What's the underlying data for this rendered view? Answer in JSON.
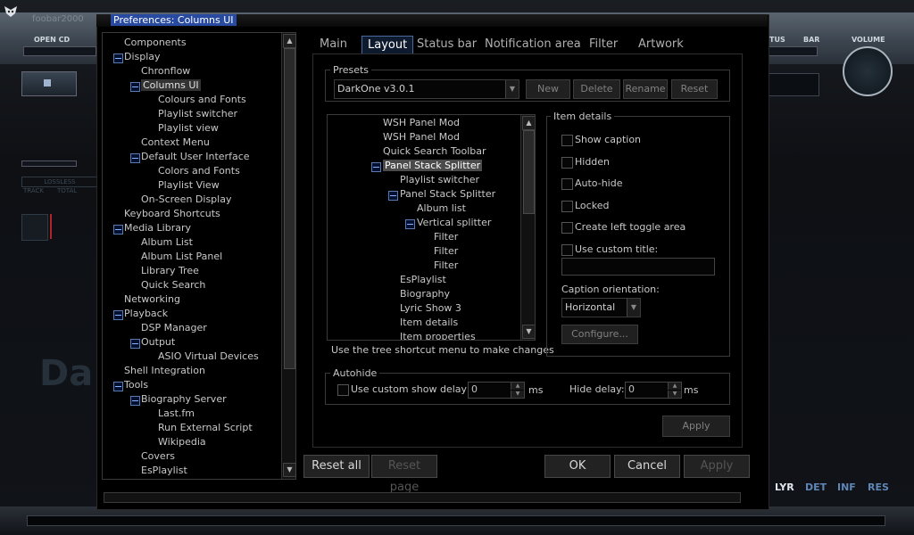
{
  "background": {
    "player_title": "foobar2000",
    "labels": {
      "open_cd": "OPEN CD",
      "tus": "TUS",
      "bar": "BAR",
      "volume": "VOLUME",
      "lossless": "LOSSLESS",
      "track": "TRACK",
      "total": "TOTAL"
    },
    "big_text": "Da",
    "side_tabs": [
      "LYR",
      "DET",
      "INF",
      "RES"
    ]
  },
  "dialog": {
    "title": "Preferences: Columns UI",
    "tree": [
      {
        "label": "Components",
        "level": 0,
        "expander": false
      },
      {
        "label": "Display",
        "level": 0,
        "expander": true
      },
      {
        "label": "Chronflow",
        "level": 1,
        "expander": false
      },
      {
        "label": "Columns UI",
        "level": 1,
        "expander": true,
        "selected": true
      },
      {
        "label": "Colours and Fonts",
        "level": 2,
        "expander": false
      },
      {
        "label": "Playlist switcher",
        "level": 2,
        "expander": false
      },
      {
        "label": "Playlist view",
        "level": 2,
        "expander": false
      },
      {
        "label": "Context Menu",
        "level": 1,
        "expander": false
      },
      {
        "label": "Default User Interface",
        "level": 1,
        "expander": true
      },
      {
        "label": "Colors and Fonts",
        "level": 2,
        "expander": false
      },
      {
        "label": "Playlist View",
        "level": 2,
        "expander": false
      },
      {
        "label": "On-Screen Display",
        "level": 1,
        "expander": false
      },
      {
        "label": "Keyboard Shortcuts",
        "level": 0,
        "expander": false
      },
      {
        "label": "Media Library",
        "level": 0,
        "expander": true
      },
      {
        "label": "Album List",
        "level": 1,
        "expander": false
      },
      {
        "label": "Album List Panel",
        "level": 1,
        "expander": false
      },
      {
        "label": "Library Tree",
        "level": 1,
        "expander": false
      },
      {
        "label": "Quick Search",
        "level": 1,
        "expander": false
      },
      {
        "label": "Networking",
        "level": 0,
        "expander": false
      },
      {
        "label": "Playback",
        "level": 0,
        "expander": true
      },
      {
        "label": "DSP Manager",
        "level": 1,
        "expander": false
      },
      {
        "label": "Output",
        "level": 1,
        "expander": true
      },
      {
        "label": "ASIO Virtual Devices",
        "level": 2,
        "expander": false
      },
      {
        "label": "Shell Integration",
        "level": 0,
        "expander": false
      },
      {
        "label": "Tools",
        "level": 0,
        "expander": true
      },
      {
        "label": "Biography Server",
        "level": 1,
        "expander": true
      },
      {
        "label": "Last.fm",
        "level": 2,
        "expander": false
      },
      {
        "label": "Run External Script",
        "level": 2,
        "expander": false
      },
      {
        "label": "Wikipedia",
        "level": 2,
        "expander": false
      },
      {
        "label": "Covers",
        "level": 1,
        "expander": false
      },
      {
        "label": "EsPlaylist",
        "level": 1,
        "expander": false
      }
    ],
    "tabs": [
      {
        "label": "Main",
        "active": false
      },
      {
        "label": "Layout",
        "active": true
      },
      {
        "label": "Status bar",
        "active": false
      },
      {
        "label": "Notification area",
        "active": false
      },
      {
        "label": "Filter",
        "active": false
      },
      {
        "label": "Artwork",
        "active": false
      }
    ],
    "presets": {
      "group_title": "Presets",
      "selected": "DarkOne v3.0.1",
      "buttons": {
        "new": "New",
        "delete": "Delete",
        "rename": "Rename",
        "reset": "Reset"
      }
    },
    "layout_tree": [
      {
        "label": "WSH Panel Mod",
        "level": 0,
        "expander": false
      },
      {
        "label": "WSH Panel Mod",
        "level": 0,
        "expander": false
      },
      {
        "label": "Quick Search Toolbar",
        "level": 0,
        "expander": false
      },
      {
        "label": "Panel Stack Splitter",
        "level": 0,
        "expander": true,
        "selected": true
      },
      {
        "label": "Playlist switcher",
        "level": 1,
        "expander": false
      },
      {
        "label": "Panel Stack Splitter",
        "level": 1,
        "expander": true
      },
      {
        "label": "Album list",
        "level": 2,
        "expander": false
      },
      {
        "label": "Vertical splitter",
        "level": 2,
        "expander": true
      },
      {
        "label": "Filter",
        "level": 3,
        "expander": false
      },
      {
        "label": "Filter",
        "level": 3,
        "expander": false
      },
      {
        "label": "Filter",
        "level": 3,
        "expander": false
      },
      {
        "label": "EsPlaylist",
        "level": 1,
        "expander": false
      },
      {
        "label": "Biography",
        "level": 1,
        "expander": false
      },
      {
        "label": "Lyric Show 3",
        "level": 1,
        "expander": false
      },
      {
        "label": "Item details",
        "level": 1,
        "expander": false
      },
      {
        "label": "Item properties",
        "level": 1,
        "expander": false
      }
    ],
    "tree_hint": "Use the tree shortcut menu to make changes",
    "item_details": {
      "group_title": "Item details",
      "checkboxes": [
        {
          "label": "Show caption",
          "checked": false
        },
        {
          "label": "Hidden",
          "checked": false
        },
        {
          "label": "Auto-hide",
          "checked": false
        },
        {
          "label": "Locked",
          "checked": false
        },
        {
          "label": "Create left toggle area",
          "checked": false
        },
        {
          "label": "Use custom title:",
          "checked": false
        }
      ],
      "custom_title_value": "",
      "caption_orientation_label": "Caption orientation:",
      "caption_orientation_value": "Horizontal",
      "configure_label": "Configure..."
    },
    "autohide": {
      "group_title": "Autohide",
      "use_custom_delay_label": "Use custom show delay of",
      "show_delay_value": "0",
      "ms_label": "ms",
      "hide_delay_label": "Hide delay:",
      "hide_delay_value": "0",
      "hide_ms_label": "ms"
    },
    "apply_label": "Apply",
    "footer": {
      "reset_all": "Reset all",
      "reset_page": "Reset page",
      "ok": "OK",
      "cancel": "Cancel",
      "apply": "Apply"
    }
  }
}
